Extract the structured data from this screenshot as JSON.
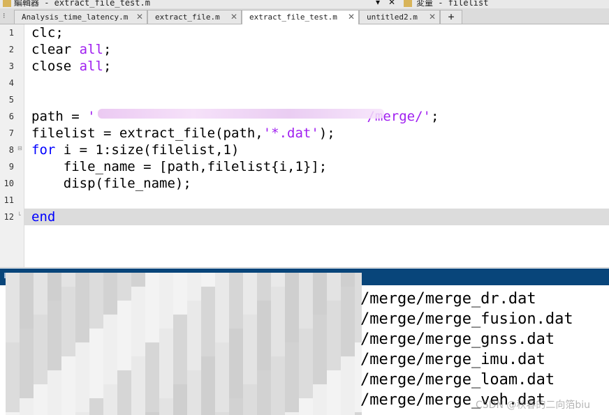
{
  "window": {
    "editor_title": "編輯器 - extract_file_test.m",
    "variable_title": "変量 - filelist",
    "menu_arrow": "▾",
    "close_glyph": "✕"
  },
  "tabs": [
    {
      "label": "Analysis_time_latency.m",
      "active": false
    },
    {
      "label": "extract_file.m",
      "active": false
    },
    {
      "label": "extract_file_test.m",
      "active": true
    },
    {
      "label": "untitled2.m",
      "active": false
    }
  ],
  "tab_add_label": "+",
  "editor": {
    "lines": [
      {
        "num": "1",
        "parts": [
          {
            "t": "clc;",
            "c": ""
          }
        ]
      },
      {
        "num": "2",
        "parts": [
          {
            "t": "clear ",
            "c": ""
          },
          {
            "t": "all",
            "c": "str"
          },
          {
            "t": ";",
            "c": ""
          }
        ]
      },
      {
        "num": "3",
        "parts": [
          {
            "t": "close ",
            "c": ""
          },
          {
            "t": "all",
            "c": "str"
          },
          {
            "t": ";",
            "c": ""
          }
        ]
      },
      {
        "num": "4",
        "parts": []
      },
      {
        "num": "5",
        "parts": []
      },
      {
        "num": "6",
        "parts": [
          {
            "t": "path = ",
            "c": ""
          },
          {
            "t": "'",
            "c": "str"
          },
          {
            "t": "                                  ",
            "c": "str"
          },
          {
            "t": "/merge/'",
            "c": "str"
          },
          {
            "t": ";",
            "c": ""
          }
        ]
      },
      {
        "num": "7",
        "parts": [
          {
            "t": "filelist = extract_file(path,",
            "c": ""
          },
          {
            "t": "'*.dat'",
            "c": "str"
          },
          {
            "t": ");",
            "c": ""
          }
        ]
      },
      {
        "num": "8",
        "parts": [
          {
            "t": "for",
            "c": "kw"
          },
          {
            "t": " i = 1:size(filelist,1)",
            "c": ""
          }
        ]
      },
      {
        "num": "9",
        "parts": [
          {
            "t": "    file_name = [path,filelist{i,1}];",
            "c": ""
          }
        ]
      },
      {
        "num": "10",
        "parts": [
          {
            "t": "    disp(file_name);",
            "c": ""
          }
        ]
      },
      {
        "num": "11",
        "parts": []
      },
      {
        "num": "12",
        "parts": [
          {
            "t": "end",
            "c": "kw"
          }
        ]
      }
    ]
  },
  "console": {
    "outputs": [
      "/merge/merge_dr.dat",
      "/merge/merge_fusion.dat",
      "/merge/merge_gnss.dat",
      "/merge/merge_imu.dat",
      "/merge/merge_loam.dat",
      "/merge/merge_veh.dat"
    ]
  },
  "watermark": "CSDN @秋春的二向箔biu",
  "colors": {
    "keyword": "#0000ff",
    "string": "#a020f0",
    "console_header": "#08457a",
    "highlight_line": "#dcdcdc"
  }
}
